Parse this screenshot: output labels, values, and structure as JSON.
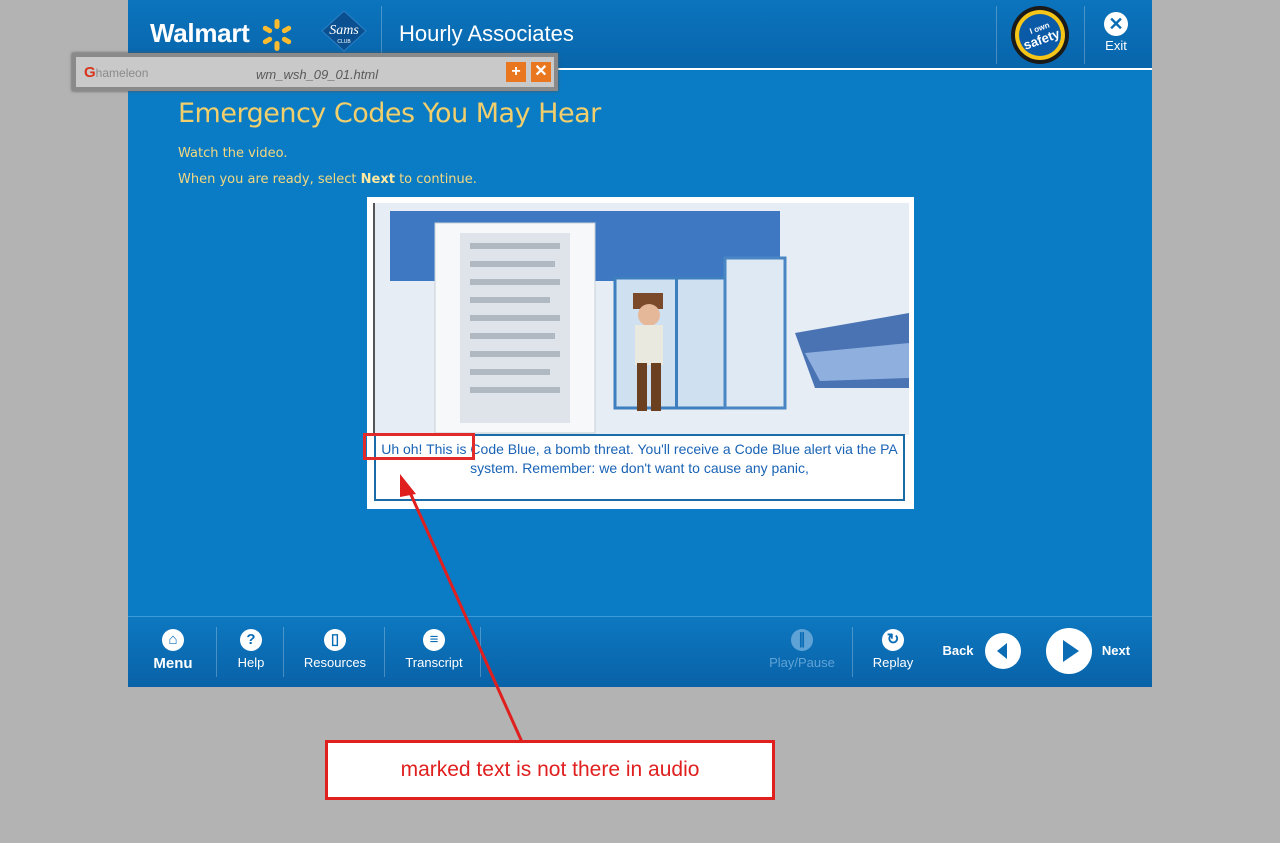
{
  "header": {
    "brand_walmart": "Walmart",
    "brand_sams": "Sams",
    "brand_sams_sub": "CLUB",
    "course_title": "Hourly Associates",
    "safety_badge_line1": "I own",
    "safety_badge_line2": "safety",
    "exit_label": "Exit"
  },
  "popup": {
    "app_name": "hameleon",
    "filename": "wm_wsh_09_01.html",
    "add_icon": "plus-icon",
    "close_icon": "close-icon"
  },
  "content": {
    "heading": "Emergency Codes You May Hear",
    "instruction_1": "Watch the video.",
    "instruction_2_pre": "When you are ready, select ",
    "instruction_2_bold": "Next",
    "instruction_2_post": " to continue.",
    "caption": "Uh oh! This is Code Blue, a bomb threat.  You'll receive a Code Blue alert via the PA system.  Remember: we don't want to cause any panic,"
  },
  "footer": {
    "menu": "Menu",
    "help": "Help",
    "resources": "Resources",
    "transcript": "Transcript",
    "play_pause": "Play/Pause",
    "replay": "Replay",
    "back": "Back",
    "next": "Next"
  },
  "annotation": {
    "note": "marked text is not there in audio",
    "color": "#e01f1f"
  },
  "colors": {
    "app_blue": "#0a7cc5",
    "heading_gold": "#f1cf6d",
    "spark_yellow": "#fdbb30"
  }
}
